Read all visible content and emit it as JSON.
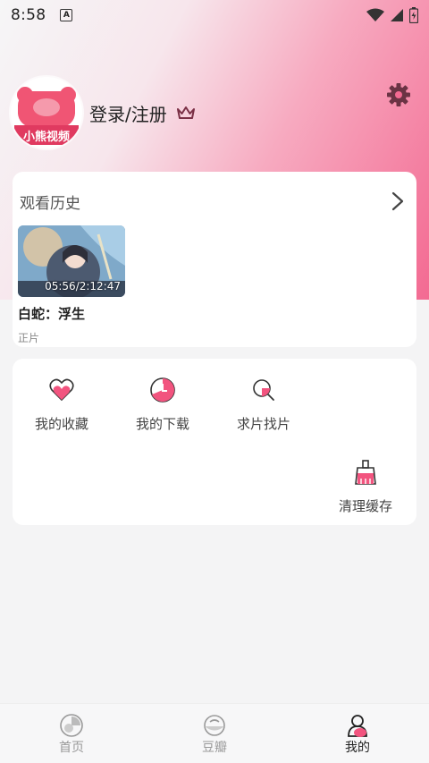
{
  "status_bar": {
    "time": "8:58",
    "notification_badge": "A"
  },
  "profile": {
    "avatar_text": "小熊视频",
    "login_label": "登录/注册"
  },
  "history": {
    "title": "观看历史",
    "items": [
      {
        "title": "白蛇：浮生",
        "subtitle": "正片",
        "progress_text": "05:56/2:12:47"
      }
    ]
  },
  "tools": [
    {
      "label": "我的收藏",
      "icon": "heart-icon"
    },
    {
      "label": "我的下载",
      "icon": "download-icon"
    },
    {
      "label": "求片找片",
      "icon": "search-icon"
    },
    {
      "label": "清理缓存",
      "icon": "broom-icon"
    }
  ],
  "bottom_nav": [
    {
      "label": "首页",
      "icon": "home-icon",
      "active": false
    },
    {
      "label": "豆瓣",
      "icon": "douban-icon",
      "active": false
    },
    {
      "label": "我的",
      "icon": "profile-icon",
      "active": true
    }
  ],
  "colors": {
    "accent": "#f2547f",
    "gradient_end": "#f36a92"
  }
}
